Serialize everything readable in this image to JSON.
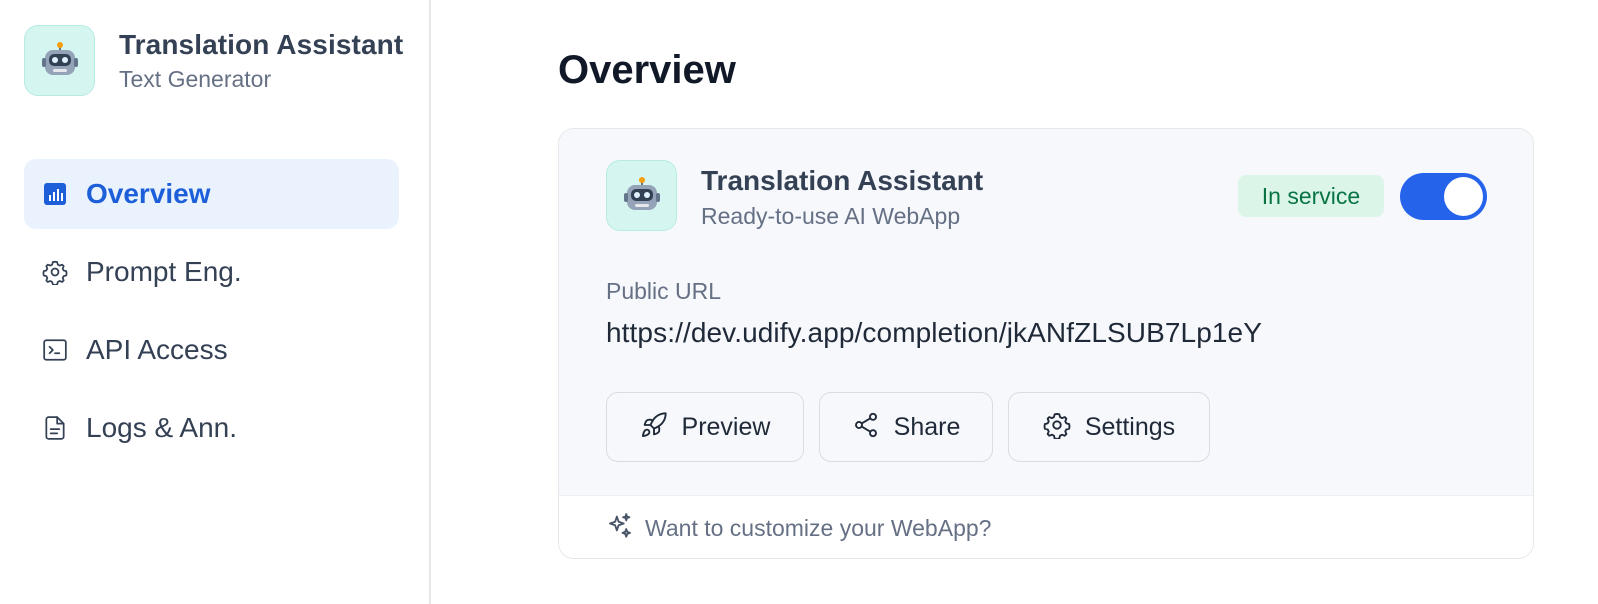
{
  "app": {
    "name": "Translation Assistant",
    "type": "Text Generator",
    "icon": "robot-emoji"
  },
  "sidebar": {
    "items": [
      {
        "label": "Overview",
        "icon": "bar-chart-icon",
        "active": true
      },
      {
        "label": "Prompt Eng.",
        "icon": "gear-icon",
        "active": false
      },
      {
        "label": "API Access",
        "icon": "terminal-icon",
        "active": false
      },
      {
        "label": "Logs & Ann.",
        "icon": "document-icon",
        "active": false
      }
    ]
  },
  "main": {
    "title": "Overview",
    "card": {
      "title": "Translation Assistant",
      "subtitle": "Ready-to-use AI WebApp",
      "status": "In service",
      "toggle_on": true,
      "url_label": "Public URL",
      "url": "https://dev.udify.app/completion/jkANfZLSUB7Lp1eY",
      "buttons": {
        "preview": "Preview",
        "share": "Share",
        "settings": "Settings"
      },
      "footer_text": "Want to customize your WebApp?"
    }
  },
  "colors": {
    "accent": "#2563eb",
    "active_nav_bg": "#eaf3fd",
    "active_nav_text": "#1d5fd9",
    "status_bg": "#dcf5e9",
    "status_text": "#087443",
    "avatar_bg": "#d5f5f0"
  }
}
